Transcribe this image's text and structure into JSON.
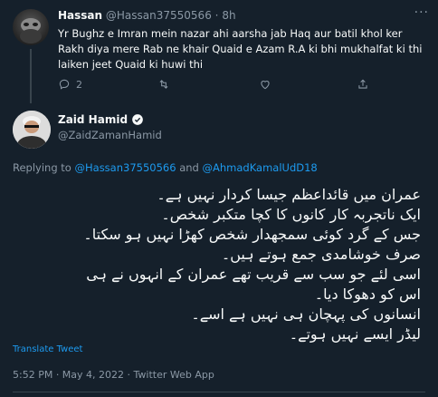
{
  "reply": {
    "name": "Hassan",
    "handle": "@Hassan37550566",
    "dot": "·",
    "time": "8h",
    "more": "···",
    "text": "Yr Bughz e Imran mein nazar ahi aarsha jab Haq aur batil khol ker Rakh diya mere Rab ne khair Quaid e Azam R.A ki bhi mukhalfat ki thi laiken jeet Quaid ki huwi thi",
    "reply_count": "2",
    "retweet_count": "",
    "like_count": ""
  },
  "tweet": {
    "name": "Zaid Hamid",
    "handle": "@ZaidZamanHamid",
    "replying_prefix": "Replying to",
    "mention1": "@Hassan37550566",
    "and": "and",
    "mention2": "@AhmadKamalUdD18",
    "lines": [
      "عمران میں قائداعظم جیسا کردار نہیں ہے۔",
      "ایک ناتجربہ کار کانوں کا کچا متکبر شخص۔",
      "جس کے گرد کوئی سمجھدار شخص کھڑا نہیں ہو سکتا۔",
      "صرف خوشامدی جمع ہوتے ہیں۔",
      "اسی لئے جو سب سے قریب تھے عمران کے انہوں نے ہی",
      "اس کو دھوکا دیا۔",
      "انسانوں کی پہچان ہی نہیں ہے اسے۔",
      "لیڈر ایسے نہیں ہوتے۔"
    ],
    "translate": "Translate Tweet",
    "meta": "5:52 PM · May 4, 2022 · Twitter Web App"
  }
}
